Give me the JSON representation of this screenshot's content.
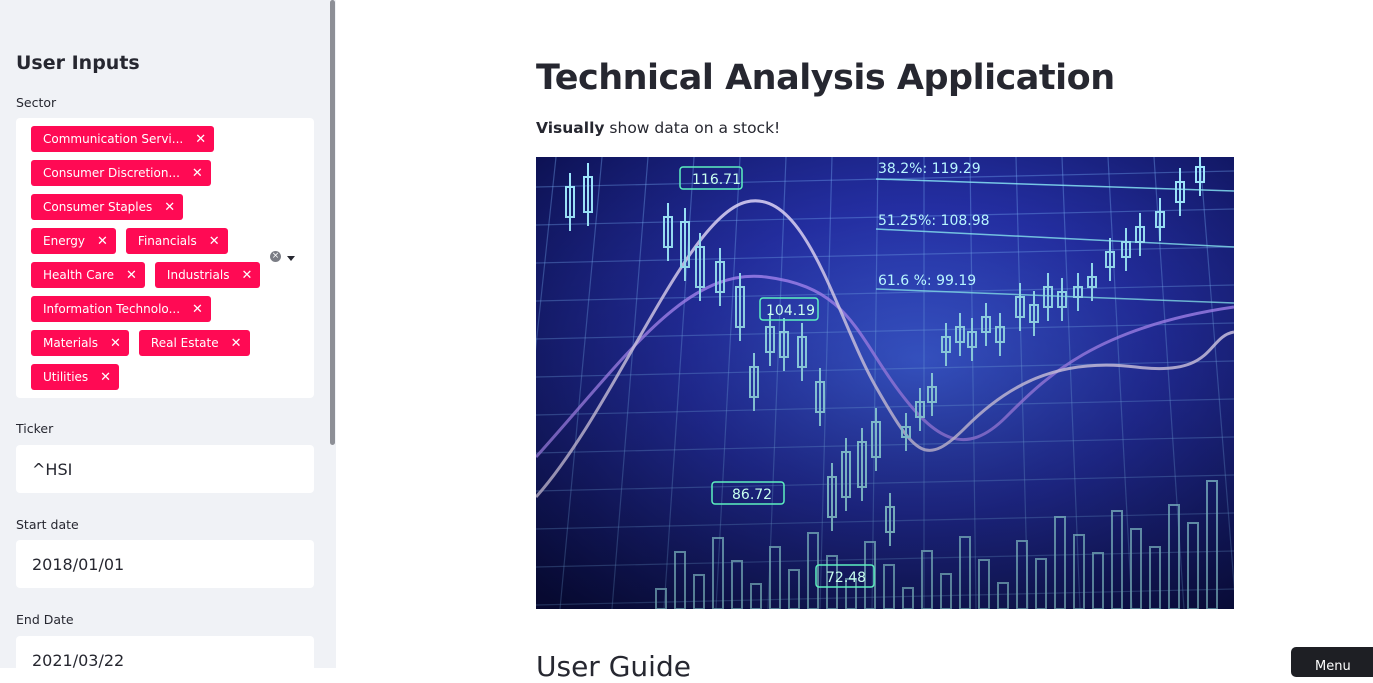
{
  "sidebar": {
    "title": "User Inputs",
    "sector": {
      "label": "Sector",
      "tags": [
        [
          "Communication Servi..."
        ],
        [
          "Consumer Discretion..."
        ],
        [
          "Consumer Staples"
        ],
        [
          "Energy",
          "Financials"
        ],
        [
          "Health Care",
          "Industrials"
        ],
        [
          "Information Technolo..."
        ],
        [
          "Materials",
          "Real Estate"
        ],
        [
          "Utilities"
        ]
      ],
      "remove_glyph": "✕"
    },
    "ticker": {
      "label": "Ticker",
      "value": "^HSI"
    },
    "start_date": {
      "label": "Start date",
      "value": "2018/01/01"
    },
    "end_date": {
      "label": "End Date",
      "value": "2021/03/22"
    }
  },
  "main": {
    "title": "Technical Analysis Application",
    "subtitle_bold": "Visually",
    "subtitle_rest": " show data on a stock!",
    "hero_labels": {
      "fib1": "38.2%: 119.29",
      "fib2": "51.25%: 108.98",
      "fib3": "61.6 %: 99.19",
      "p1": "116.71",
      "p2": "104.19",
      "p3": "86.72",
      "p4": "72.48"
    },
    "section_heading": "User Guide",
    "menu_button": "Menu"
  },
  "colors": {
    "tag": "#ff0a54",
    "sidebar_bg": "#f0f2f6",
    "text": "#262730"
  }
}
